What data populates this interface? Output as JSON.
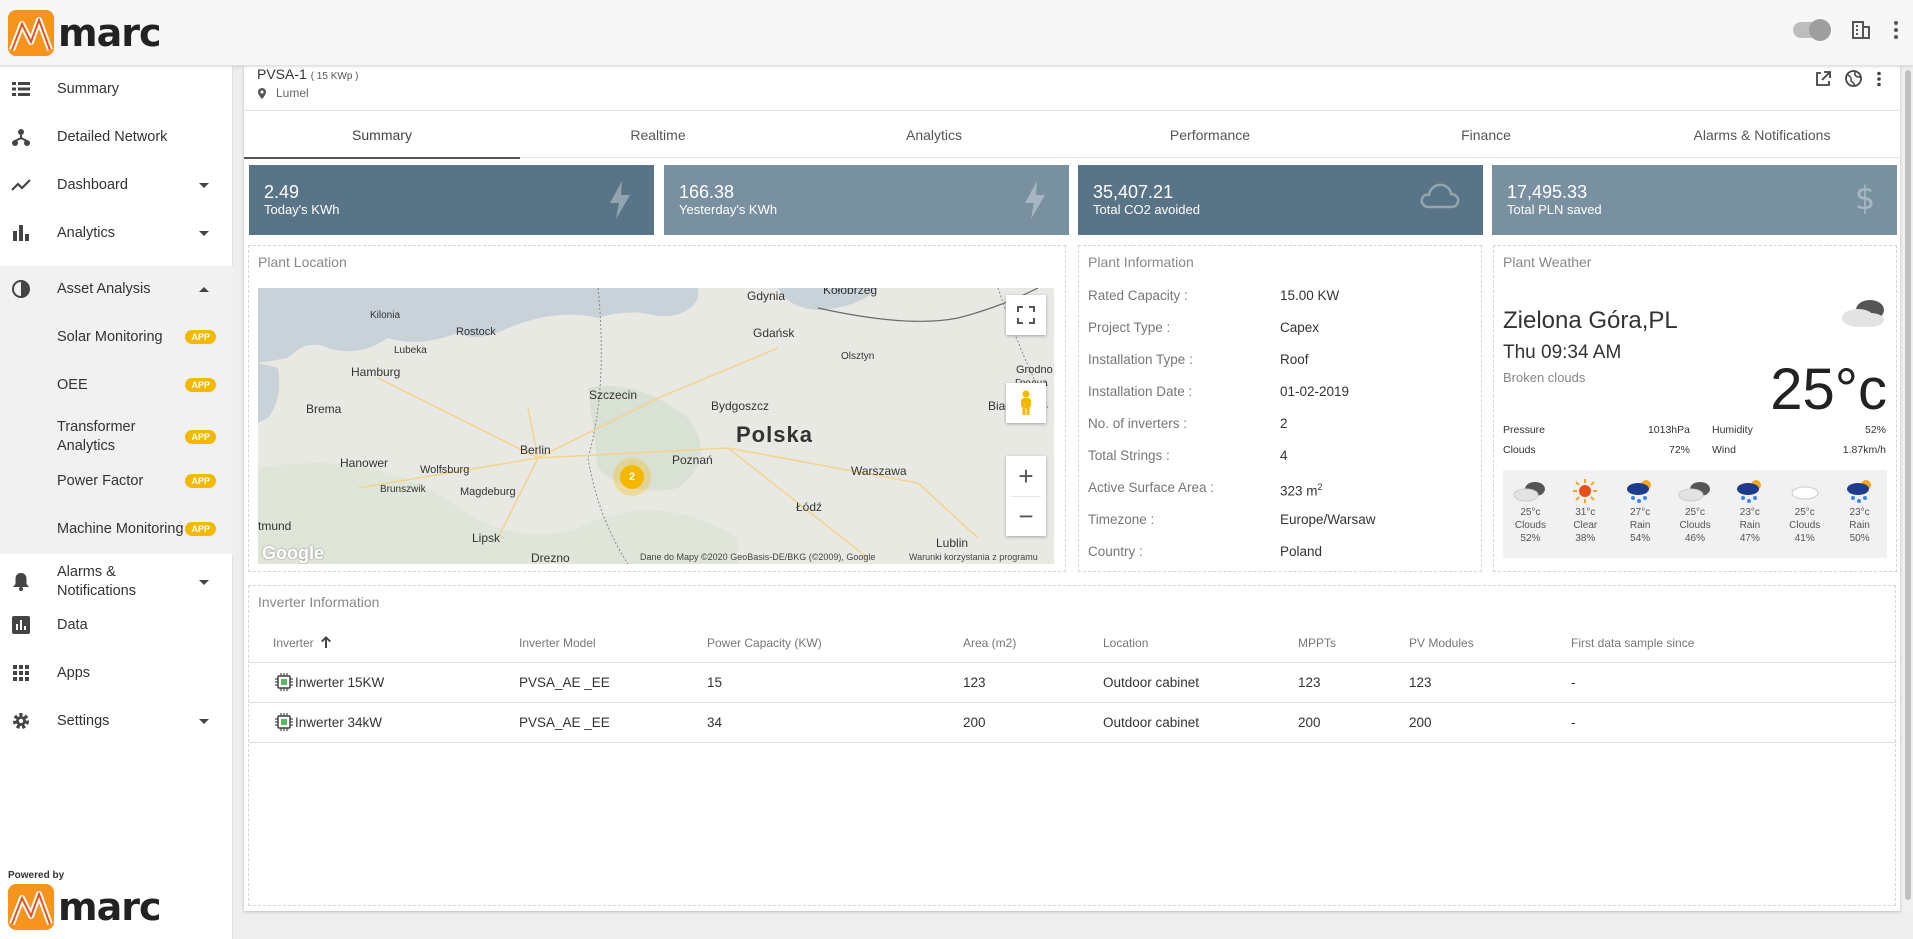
{
  "brand": {
    "name": "marc",
    "accent": "#f7941d",
    "powered_by": "Powered by"
  },
  "topbar": {
    "icons": [
      "toggle-switch",
      "building-icon",
      "more-vert-icon"
    ]
  },
  "sidebar": {
    "items": [
      {
        "label": "Summary",
        "icon": "list-icon"
      },
      {
        "label": "Detailed Network",
        "icon": "network-icon"
      },
      {
        "label": "Dashboard",
        "icon": "trend-icon"
      },
      {
        "label": "Analytics",
        "icon": "bar-chart-icon"
      },
      {
        "label": "Asset Analysis",
        "icon": "donut-icon"
      },
      {
        "label": "Alarms & Notifications",
        "icon": "bell-icon"
      },
      {
        "label": "Data",
        "icon": "data-icon"
      },
      {
        "label": "Apps",
        "icon": "apps-grid-icon"
      },
      {
        "label": "Settings",
        "icon": "gear-icon"
      }
    ],
    "sub_items": [
      {
        "label": "Solar Monitoring",
        "badge": "APP"
      },
      {
        "label": "OEE",
        "badge": "APP"
      },
      {
        "label": "Transformer Analytics",
        "badge": "APP"
      },
      {
        "label": "Power Factor",
        "badge": "APP"
      },
      {
        "label": "Machine Monitoring",
        "badge": "APP"
      }
    ]
  },
  "plant": {
    "name": "PVSA-1",
    "capacity": "( 15 KWp )",
    "location": "Lumel"
  },
  "tabs": [
    "Summary",
    "Realtime",
    "Analytics",
    "Performance",
    "Finance",
    "Alarms & Notifications"
  ],
  "stats": [
    {
      "value": "2.49",
      "caption": "Today's KWh",
      "color": "#597487"
    },
    {
      "value": "166.38",
      "caption": "Yesterday's KWh",
      "color": "#7990a1"
    },
    {
      "value": "35,407.21",
      "caption": "Total CO2 avoided",
      "color": "#597487"
    },
    {
      "value": "17,495.33",
      "caption": "Total PLN saved",
      "color": "#7990a1"
    }
  ],
  "plant_location": {
    "title": "Plant Location",
    "map_labels": {
      "gdynia": "Gdynia",
      "gdansk": "Gdańsk",
      "kolobrzeg": "Kołobrzeg",
      "kilonia": "Kilonia",
      "rostock": "Rostock",
      "lubeka": "Lubeka",
      "olsztyn": "Olsztyn",
      "grodno": "Grodno",
      "grodno_2": "Гродна",
      "hamburg": "Hamburg",
      "szczecin": "Szczecin",
      "bydgoszcz": "Bydgoszcz",
      "bialystok": "Białysto",
      "brema": "Brema",
      "polska": "Polska",
      "berlin": "Berlin",
      "poznan": "Poznań",
      "hanower": "Hanower",
      "wolfsburg": "Wolfsburg",
      "warszawa": "Warszawa",
      "brunszwik": "Brunszwik",
      "magdeburg": "Magdeburg",
      "lodz": "Łódź",
      "dortmund": "tmund",
      "lipsk": "Lipsk",
      "lublin": "Lublin",
      "drezno": "Drezno"
    },
    "cluster_count": "2",
    "google": "Google",
    "attribution": "Dane do Mapy ©2020 GeoBasis-DE/BKG (©2009), Google",
    "terms": "Warunki korzystania z programu",
    "zoom_in": "+",
    "zoom_out": "−"
  },
  "plant_info": {
    "title": "Plant Information",
    "rows": [
      {
        "k": "Rated Capacity :",
        "v": "15.00 KW"
      },
      {
        "k": "Project Type :",
        "v": "Capex"
      },
      {
        "k": "Installation Type :",
        "v": "Roof"
      },
      {
        "k": "Installation Date :",
        "v": "01-02-2019"
      },
      {
        "k": "No. of inverters :",
        "v": "2"
      },
      {
        "k": "Total Strings :",
        "v": "4"
      },
      {
        "k": "Active Surface Area :",
        "v": "323 m",
        "sup": "2"
      },
      {
        "k": "Timezone :",
        "v": "Europe/Warsaw"
      },
      {
        "k": "Country :",
        "v": "Poland"
      }
    ]
  },
  "weather": {
    "title": "Plant Weather",
    "city": "Zielona Góra,PL",
    "time": "Thu 09:34 AM",
    "desc": "Broken clouds",
    "temp": "25°c",
    "pressure_label": "Pressure",
    "pressure": "1013hPa",
    "humidity_label": "Humidity",
    "humidity": "52%",
    "clouds_label": "Clouds",
    "clouds": "72%",
    "wind_label": "Wind",
    "wind": "1.87km/h",
    "forecast": [
      {
        "temp": "25°c",
        "cond": "Clouds",
        "pct": "52%",
        "icon": "cloud-icon"
      },
      {
        "temp": "31°c",
        "cond": "Clear",
        "pct": "38%",
        "icon": "sun-icon"
      },
      {
        "temp": "27°c",
        "cond": "Rain",
        "pct": "54%",
        "icon": "rain-icon"
      },
      {
        "temp": "25°c",
        "cond": "Clouds",
        "pct": "46%",
        "icon": "cloud-icon"
      },
      {
        "temp": "23°c",
        "cond": "Rain",
        "pct": "47%",
        "icon": "rain-icon"
      },
      {
        "temp": "25°c",
        "cond": "Clouds",
        "pct": "41%",
        "icon": "cloud-icon"
      },
      {
        "temp": "23°c",
        "cond": "Rain",
        "pct": "50%",
        "icon": "rain-icon"
      }
    ]
  },
  "inverters": {
    "title": "Inverter Information",
    "columns": [
      "Inverter",
      "Inverter Model",
      "Power Capacity (KW)",
      "Area (m2)",
      "Location",
      "MPPTs",
      "PV Modules",
      "First data sample since"
    ],
    "rows": [
      [
        "Inwerter 15KW",
        "PVSA_AE _EE",
        "15",
        "123",
        "Outdoor cabinet",
        "123",
        "123",
        "-"
      ],
      [
        "Inwerter 34kW",
        "PVSA_AE _EE",
        "34",
        "200",
        "Outdoor cabinet",
        "200",
        "200",
        "-"
      ]
    ]
  }
}
